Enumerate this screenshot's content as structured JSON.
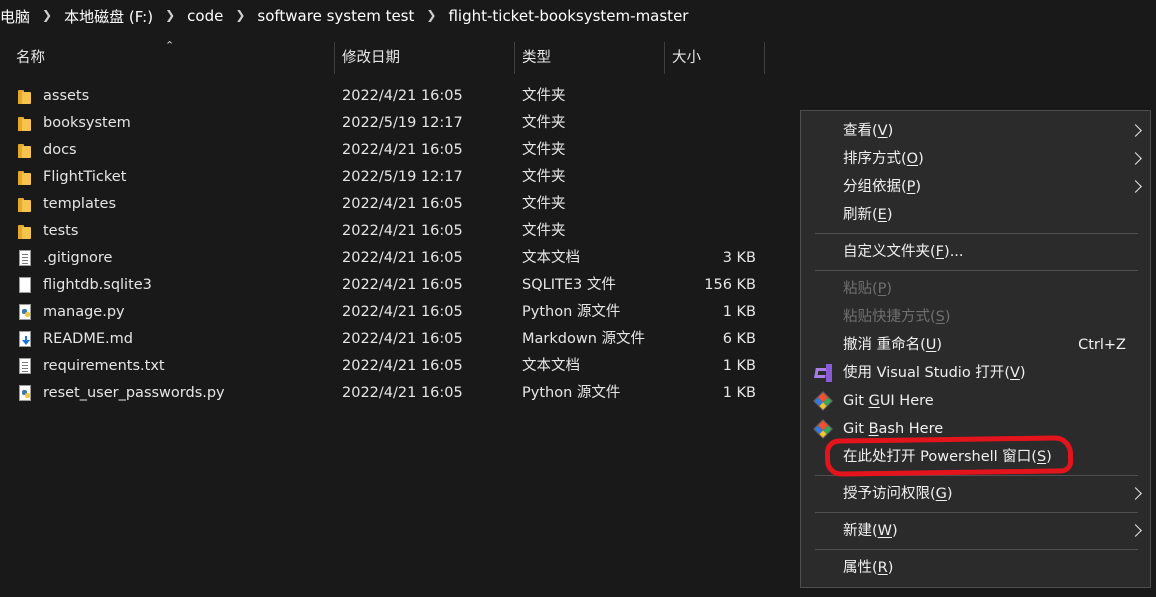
{
  "breadcrumb": [
    "电脑",
    "本地磁盘 (F:)",
    "code",
    "software system test",
    "flight-ticket-booksystem-master"
  ],
  "columns": {
    "name": "名称",
    "date": "修改日期",
    "type": "类型",
    "size": "大小"
  },
  "files": [
    {
      "name": "assets",
      "date": "2022/4/21 16:05",
      "type": "文件夹",
      "size": "",
      "icon": "folder-icon"
    },
    {
      "name": "booksystem",
      "date": "2022/5/19 12:17",
      "type": "文件夹",
      "size": "",
      "icon": "folder-icon"
    },
    {
      "name": "docs",
      "date": "2022/4/21 16:05",
      "type": "文件夹",
      "size": "",
      "icon": "folder-icon"
    },
    {
      "name": "FlightTicket",
      "date": "2022/5/19 12:17",
      "type": "文件夹",
      "size": "",
      "icon": "folder-icon"
    },
    {
      "name": "templates",
      "date": "2022/4/21 16:05",
      "type": "文件夹",
      "size": "",
      "icon": "folder-icon"
    },
    {
      "name": "tests",
      "date": "2022/4/21 16:05",
      "type": "文件夹",
      "size": "",
      "icon": "folder-icon"
    },
    {
      "name": ".gitignore",
      "date": "2022/4/21 16:05",
      "type": "文本文档",
      "size": "3 KB",
      "icon": "text-file-icon"
    },
    {
      "name": "flightdb.sqlite3",
      "date": "2022/4/21 16:05",
      "type": "SQLITE3 文件",
      "size": "156 KB",
      "icon": "blank-file-icon"
    },
    {
      "name": "manage.py",
      "date": "2022/4/21 16:05",
      "type": "Python 源文件",
      "size": "1 KB",
      "icon": "python-file-icon"
    },
    {
      "name": "README.md",
      "date": "2022/4/21 16:05",
      "type": "Markdown 源文件",
      "size": "6 KB",
      "icon": "markdown-file-icon"
    },
    {
      "name": "requirements.txt",
      "date": "2022/4/21 16:05",
      "type": "文本文档",
      "size": "1 KB",
      "icon": "text-file-icon"
    },
    {
      "name": "reset_user_passwords.py",
      "date": "2022/4/21 16:05",
      "type": "Python 源文件",
      "size": "1 KB",
      "icon": "python-file-icon"
    }
  ],
  "context_menu": {
    "view": {
      "text": "查看",
      "key": "V"
    },
    "sort": {
      "text": "排序方式",
      "key": "O"
    },
    "group": {
      "text": "分组依据",
      "key": "P"
    },
    "refresh": {
      "text": "刷新",
      "key": "E"
    },
    "customize": {
      "text": "自定义文件夹",
      "key": "F",
      "suffix": "..."
    },
    "paste": {
      "text": "粘贴",
      "key": "P"
    },
    "paste_shortcut": {
      "text": "粘贴快捷方式",
      "key": "S"
    },
    "undo": {
      "text": "撤消 重命名",
      "key": "U",
      "shortcut": "Ctrl+Z"
    },
    "vs": {
      "text": "使用 Visual Studio 打开",
      "key": "V",
      "icon": "visual-studio-icon"
    },
    "git_gui": {
      "prefix": "Git ",
      "key": "G",
      "rest": "UI Here",
      "icon": "git-icon"
    },
    "git_bash": {
      "prefix": "Git ",
      "key": "B",
      "rest": "ash Here",
      "icon": "git-icon"
    },
    "powershell": {
      "text": "在此处打开 Powershell 窗口",
      "key": "S"
    },
    "grant": {
      "text": "授予访问权限",
      "key": "G"
    },
    "new": {
      "text": "新建",
      "key": "W"
    },
    "properties": {
      "text": "属性",
      "key": "R"
    }
  },
  "colors": {
    "background": "#191919",
    "menu": "#2b2b2b",
    "highlight": "#e3141c",
    "folder": "#f6c44c"
  }
}
